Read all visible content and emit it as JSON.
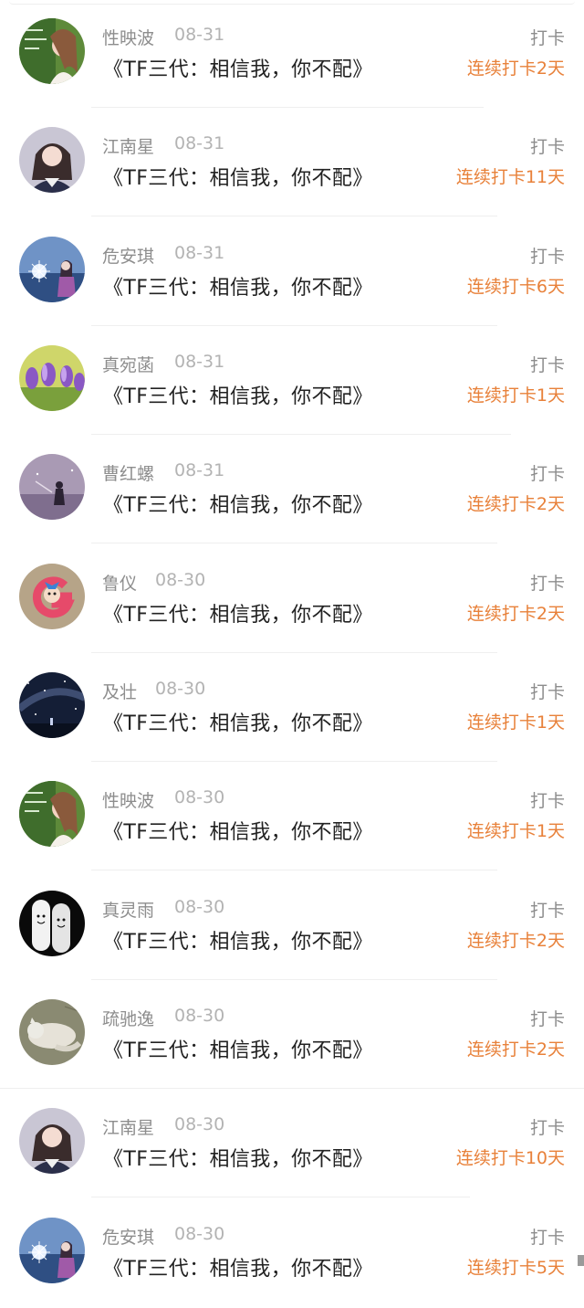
{
  "feed": {
    "items": [
      {
        "name": "性映波",
        "date": "08-31",
        "title": "《TF三代：相信我，你不配》",
        "action": "打卡",
        "streak": "连续打卡2天",
        "avatar_icon": "avatar-girl-green-icon"
      },
      {
        "name": "江南星",
        "date": "08-31",
        "title": "《TF三代：相信我，你不配》",
        "action": "打卡",
        "streak": "连续打卡11天",
        "avatar_icon": "avatar-girl-uniform-icon"
      },
      {
        "name": "危安琪",
        "date": "08-31",
        "title": "《TF三代：相信我，你不配》",
        "action": "打卡",
        "streak": "连续打卡6天",
        "avatar_icon": "avatar-girl-sparkler-icon"
      },
      {
        "name": "真宛菡",
        "date": "08-31",
        "title": "《TF三代：相信我，你不配》",
        "action": "打卡",
        "streak": "连续打卡1天",
        "avatar_icon": "avatar-purple-flowers-icon"
      },
      {
        "name": "曹红螺",
        "date": "08-31",
        "title": "《TF三代：相信我，你不配》",
        "action": "打卡",
        "streak": "连续打卡2天",
        "avatar_icon": "avatar-purple-silhouette-icon"
      },
      {
        "name": "鲁仪",
        "date": "08-30",
        "title": "《TF三代：相信我，你不配》",
        "action": "打卡",
        "streak": "连续打卡2天",
        "avatar_icon": "avatar-letter-g-cartoon-icon"
      },
      {
        "name": "及壮",
        "date": "08-30",
        "title": "《TF三代：相信我，你不配》",
        "action": "打卡",
        "streak": "连续打卡1天",
        "avatar_icon": "avatar-night-sky-icon"
      },
      {
        "name": "性映波",
        "date": "08-30",
        "title": "《TF三代：相信我，你不配》",
        "action": "打卡",
        "streak": "连续打卡1天",
        "avatar_icon": "avatar-girl-green-icon"
      },
      {
        "name": "真灵雨",
        "date": "08-30",
        "title": "《TF三代：相信我，你不配》",
        "action": "打卡",
        "streak": "连续打卡2天",
        "avatar_icon": "avatar-finger-faces-icon"
      },
      {
        "name": "疏驰逸",
        "date": "08-30",
        "title": "《TF三代：相信我，你不配》",
        "action": "打卡",
        "streak": "连续打卡2天",
        "avatar_icon": "avatar-sleeping-cat-icon"
      },
      {
        "name": "江南星",
        "date": "08-30",
        "title": "《TF三代：相信我，你不配》",
        "action": "打卡",
        "streak": "连续打卡10天",
        "avatar_icon": "avatar-girl-uniform-icon"
      },
      {
        "name": "危安琪",
        "date": "08-30",
        "title": "《TF三代：相信我，你不配》",
        "action": "打卡",
        "streak": "连续打卡5天",
        "avatar_icon": "avatar-girl-sparkler-icon"
      }
    ]
  },
  "colors": {
    "streak": "#e8813a",
    "name": "#8d8d8d",
    "date": "#b3b3b3",
    "title": "#222222"
  }
}
